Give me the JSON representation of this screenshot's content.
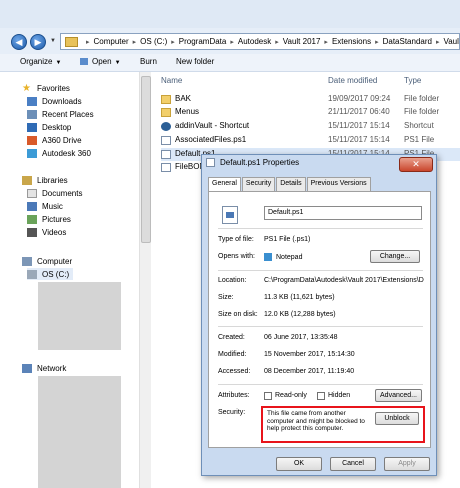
{
  "address_bar": {
    "crumbs": [
      "Computer",
      "OS (C:)",
      "ProgramData",
      "Autodesk",
      "Vault 2017",
      "Extensions",
      "DataStandard",
      "Vault"
    ]
  },
  "toolbar": {
    "organize": "Organize",
    "open": "Open",
    "burn": "Burn",
    "new_folder": "New folder"
  },
  "sidebar": {
    "favorites_header": "Favorites",
    "favorites": [
      "Downloads",
      "Recent Places",
      "Desktop",
      "A360 Drive",
      "Autodesk 360"
    ],
    "libraries_header": "Libraries",
    "libraries": [
      "Documents",
      "Music",
      "Pictures",
      "Videos"
    ],
    "computer_header": "Computer",
    "computer_items": [
      "OS (C:)"
    ],
    "network_header": "Network"
  },
  "file_list": {
    "columns": {
      "name": "Name",
      "date": "Date modified",
      "type": "Type"
    },
    "rows": [
      {
        "name": "BAK",
        "date": "19/09/2017 09:24",
        "type": "File folder",
        "icon": "folder-icon"
      },
      {
        "name": "Menus",
        "date": "21/11/2017 06:40",
        "type": "File folder",
        "icon": "folder-icon"
      },
      {
        "name": "addinVault - Shortcut",
        "date": "15/11/2017 15:14",
        "type": "Shortcut",
        "icon": "shortcut-icon"
      },
      {
        "name": "AssociatedFiles.ps1",
        "date": "15/11/2017 15:14",
        "type": "PS1 File",
        "icon": "ps1-file-icon"
      },
      {
        "name": "Default.ps1",
        "date": "15/11/2017 15:14",
        "type": "PS1 File",
        "icon": "ps1-file-icon"
      },
      {
        "name": "FileBOM",
        "date": "",
        "type": "",
        "icon": "ps1-file-icon"
      }
    ]
  },
  "dialog": {
    "title": "Default.ps1 Properties",
    "close_glyph": "✕",
    "tabs": [
      "General",
      "Security",
      "Details",
      "Previous Versions"
    ],
    "file_name": "Default.ps1",
    "type_of_file_label": "Type of file:",
    "type_of_file": "PS1 File (.ps1)",
    "opens_with_label": "Opens with:",
    "opens_with": "Notepad",
    "change_button": "Change...",
    "location_label": "Location:",
    "location": "C:\\ProgramData\\Autodesk\\Vault 2017\\Extensions\\D",
    "size_label": "Size:",
    "size": "11.3 KB (11,621 bytes)",
    "size_on_disk_label": "Size on disk:",
    "size_on_disk": "12.0 KB (12,288 bytes)",
    "created_label": "Created:",
    "created": "06 June 2017, 13:35:48",
    "modified_label": "Modified:",
    "modified": "15 November 2017, 15:14:30",
    "accessed_label": "Accessed:",
    "accessed": "08 December 2017, 11:19:40",
    "attributes_label": "Attributes:",
    "read_only": "Read-only",
    "hidden": "Hidden",
    "advanced_button": "Advanced...",
    "security_label": "Security:",
    "security_text": "This file came from another computer and might be blocked to help protect this computer.",
    "unblock_button": "Unblock",
    "ok_button": "OK",
    "cancel_button": "Cancel",
    "apply_button": "Apply",
    "highlight_color": "#e8141b"
  }
}
